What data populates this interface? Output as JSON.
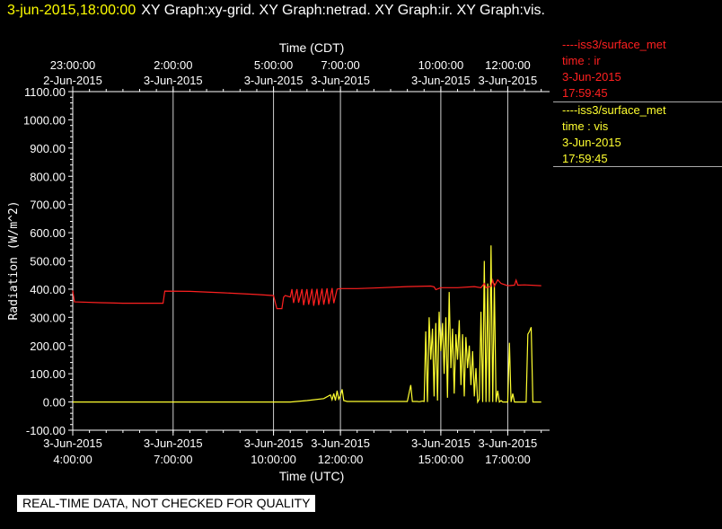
{
  "header": {
    "timestamp": "3-jun-2015,18:00:00",
    "graphs": "XY Graph:xy-grid.  XY Graph:netrad.  XY Graph:ir.  XY Graph:vis."
  },
  "legend": [
    {
      "name": "----iss3/surface_met",
      "field": "time : ir",
      "date": "3-Jun-2015",
      "time": "17:59:45",
      "color": "#ff2020"
    },
    {
      "name": "----iss3/surface_met",
      "field": "time : vis",
      "date": "3-Jun-2015",
      "time": "17:59:45",
      "color": "#ffff30"
    }
  ],
  "quality_note": "REAL-TIME DATA, NOT CHECKED FOR QUALITY",
  "chart_data": {
    "type": "line",
    "title": "",
    "xlabel": "Time (UTC)",
    "x2label": "Time (CDT)",
    "ylabel": "Radiation (W/m^2)",
    "ylim": [
      -100,
      1100
    ],
    "xlim": [
      4.0,
      18.0
    ],
    "y_ticks": [
      "1100.00",
      "1000.00",
      "900.00",
      "800.00",
      "700.00",
      "600.00",
      "500.00",
      "400.00",
      "300.00",
      "200.00",
      "100.00",
      "0.00",
      "-100.00"
    ],
    "bottom_ticks": [
      {
        "x": 4.0,
        "date": "3-Jun-2015",
        "time": "4:00:00"
      },
      {
        "x": 7.0,
        "date": "3-Jun-2015",
        "time": "7:00:00"
      },
      {
        "x": 10.0,
        "date": "3-Jun-2015",
        "time": "10:00:00"
      },
      {
        "x": 12.0,
        "date": "3-Jun-2015",
        "time": "12:00:00"
      },
      {
        "x": 15.0,
        "date": "3-Jun-2015",
        "time": "15:00:00"
      },
      {
        "x": 17.0,
        "date": "3-Jun-2015",
        "time": "17:00:00"
      }
    ],
    "top_ticks": [
      {
        "x": 4.0,
        "time": "23:00:00",
        "date": "2-Jun-2015"
      },
      {
        "x": 7.0,
        "time": "2:00:00",
        "date": "3-Jun-2015"
      },
      {
        "x": 10.0,
        "time": "5:00:00",
        "date": "3-Jun-2015"
      },
      {
        "x": 12.0,
        "time": "7:00:00",
        "date": "3-Jun-2015"
      },
      {
        "x": 15.0,
        "time": "10:00:00",
        "date": "3-Jun-2015"
      },
      {
        "x": 17.0,
        "time": "12:00:00",
        "date": "3-Jun-2015"
      }
    ],
    "grid": "vertical",
    "series": [
      {
        "name": "ir",
        "color": "#ff2020",
        "x": [
          4.0,
          4.05,
          4.8,
          5.5,
          6.2,
          6.6,
          6.7,
          6.75,
          7.5,
          8.5,
          9.5,
          10.0,
          10.1,
          10.25,
          10.3,
          10.35,
          10.5,
          10.55,
          10.6,
          10.7,
          10.75,
          10.85,
          10.9,
          11.0,
          11.05,
          11.15,
          11.2,
          11.3,
          11.35,
          11.45,
          11.5,
          11.6,
          11.65,
          11.75,
          11.8,
          11.9,
          12.0,
          12.5,
          13.0,
          14.0,
          14.7,
          14.8,
          14.85,
          15.0,
          15.5,
          16.0,
          16.2,
          16.3,
          16.35,
          16.5,
          16.55,
          16.6,
          16.7,
          16.8,
          17.0,
          17.2,
          17.25,
          17.3,
          17.5,
          18.0,
          18.0
        ],
        "y": [
          395,
          355,
          352,
          350,
          350,
          350,
          350,
          393,
          392,
          387,
          381,
          377,
          331,
          331,
          371,
          377,
          372,
          400,
          351,
          400,
          352,
          400,
          343,
          400,
          345,
          401,
          341,
          401,
          343,
          402,
          345,
          403,
          347,
          404,
          350,
          400,
          402,
          402,
          404,
          409,
          411,
          408,
          398,
          405,
          405,
          409,
          405,
          420,
          405,
          410,
          432,
          410,
          433,
          420,
          412,
          414,
          432,
          414,
          415,
          412,
          412
        ]
      },
      {
        "name": "vis",
        "color": "#ffff30",
        "x": [
          4.0,
          9.8,
          10.5,
          11.0,
          11.5,
          11.7,
          11.75,
          11.8,
          11.85,
          11.9,
          11.95,
          12.0,
          12.05,
          12.1,
          12.2,
          13.0,
          14.0,
          14.1,
          14.15,
          14.2,
          14.3,
          14.35,
          14.4,
          14.45,
          14.5,
          14.55,
          14.6,
          14.65,
          14.7,
          14.75,
          14.8,
          14.85,
          14.9,
          14.95,
          15.0,
          15.05,
          15.1,
          15.15,
          15.2,
          15.25,
          15.3,
          15.35,
          15.4,
          15.45,
          15.5,
          15.55,
          15.6,
          15.65,
          15.7,
          15.75,
          15.8,
          15.85,
          15.9,
          15.95,
          16.0,
          16.05,
          16.1,
          16.15,
          16.2,
          16.25,
          16.3,
          16.35,
          16.4,
          16.45,
          16.5,
          16.55,
          16.6,
          16.65,
          16.7,
          16.75,
          16.8,
          16.85,
          16.9,
          16.95,
          17.0,
          17.05,
          17.1,
          17.15,
          17.2,
          17.25,
          17.3,
          17.35,
          17.4,
          17.45,
          17.5,
          17.55,
          17.6,
          17.65,
          17.7,
          17.75,
          17.8,
          17.85,
          17.9,
          17.95,
          18.0
        ],
        "y": [
          0,
          0,
          0,
          5,
          12,
          25,
          8,
          30,
          5,
          40,
          10,
          22,
          45,
          5,
          2,
          2,
          2,
          60,
          2,
          2,
          2,
          1,
          2,
          3,
          2,
          250,
          0,
          300,
          150,
          260,
          20,
          280,
          5,
          320,
          180,
          280,
          100,
          300,
          15,
          390,
          120,
          260,
          30,
          240,
          150,
          290,
          60,
          240,
          20,
          230,
          120,
          200,
          60,
          180,
          20,
          120,
          0,
          10,
          320,
          0,
          500,
          0,
          420,
          0,
          555,
          0,
          420,
          0,
          40,
          0,
          5,
          0,
          0,
          0,
          0,
          210,
          0,
          30,
          0,
          0,
          0,
          0,
          0,
          0,
          0,
          0,
          240,
          250,
          265,
          0,
          0,
          0,
          0,
          0,
          0
        ]
      }
    ]
  }
}
